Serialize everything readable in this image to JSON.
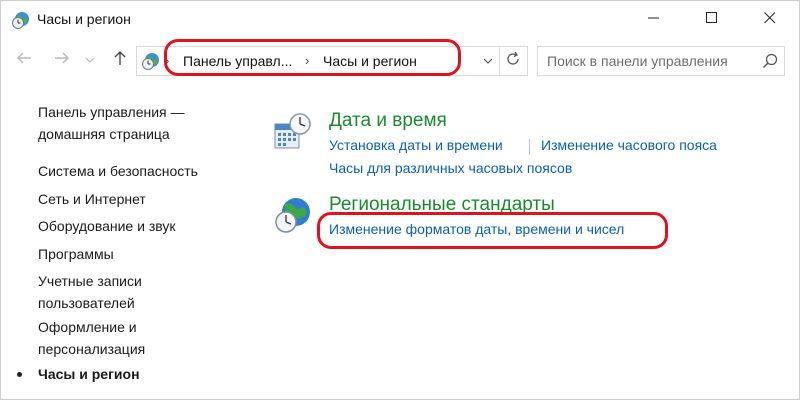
{
  "window": {
    "title": "Часы и регион",
    "app_icon": "clock-globe-icon"
  },
  "titlebar_buttons": {
    "minimize": "minimize-icon",
    "maximize": "maximize-icon",
    "close": "close-icon"
  },
  "navigation": {
    "breadcrumbs": [
      "Панель управл...",
      "Часы и регион"
    ],
    "separator": "›",
    "search_placeholder": "Поиск в панели управления"
  },
  "sidebar": {
    "items": [
      {
        "label": "Панель управления —\nдомашняя страница"
      },
      {
        "label": "Система и безопасность"
      },
      {
        "label": "Сеть и Интернет"
      },
      {
        "label": "Оборудование и звук"
      },
      {
        "label": "Программы"
      },
      {
        "label": "Учетные записи\nпользователей"
      },
      {
        "label": "Оформление и\nперсонализация"
      },
      {
        "label": "Часы и регион",
        "current": true
      }
    ]
  },
  "main": {
    "categories": [
      {
        "title": "Дата и время",
        "icon": "calendar-clock-icon",
        "links": [
          "Установка даты и времени",
          "Изменение часового пояса",
          "Часы для различных часовых поясов"
        ]
      },
      {
        "title": "Региональные стандарты",
        "icon": "globe-clock-icon",
        "links": [
          "Изменение форматов даты, времени и чисел"
        ]
      }
    ]
  },
  "colors": {
    "category_title": "#1a8a2f",
    "link": "#0a5fb4",
    "highlight": "#e0121e"
  }
}
